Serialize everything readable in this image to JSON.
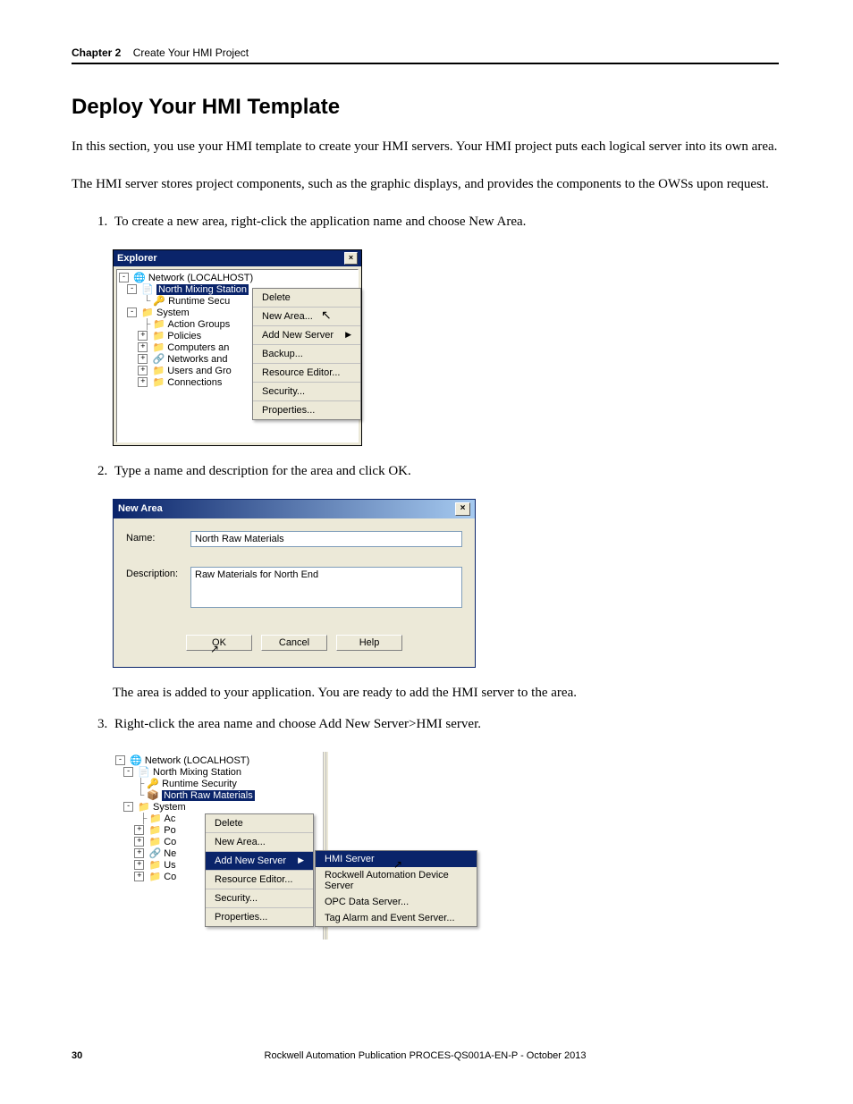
{
  "header": {
    "chapter": "Chapter 2",
    "title": "Create Your HMI Project"
  },
  "heading": "Deploy Your HMI Template",
  "p1": "In this section, you use your HMI template to create your HMI servers. Your HMI project puts each logical server into its own area.",
  "p2": "The HMI server stores project components, such as the graphic displays, and provides the components to the OWSs upon request.",
  "step1": "To create a new area, right-click the application name and choose New Area.",
  "step2": "Type a name and description for the area and click OK.",
  "step2_note": "The area is added to your application. You are ready to add the HMI server to the area.",
  "step3": "Right-click the area name and choose Add New Server>HMI server.",
  "explorer": {
    "title": "Explorer",
    "root": "Network (LOCALHOST)",
    "app": "North Mixing Station",
    "rsec": "Runtime Secu",
    "system": "System",
    "ag": "Action Groups",
    "pol": "Policies",
    "comp": "Computers an",
    "net": "Networks and",
    "usr": "Users and Gro",
    "con": "Connections"
  },
  "ctx": {
    "delete": "Delete",
    "newarea": "New Area...",
    "addserver": "Add New Server",
    "backup": "Backup...",
    "resed": "Resource Editor...",
    "security": "Security...",
    "props": "Properties..."
  },
  "dialog": {
    "title": "New Area",
    "name_label": "Name:",
    "name_val": "North Raw Materials",
    "desc_label": "Description:",
    "desc_val": "Raw Materials for North End",
    "ok": "OK",
    "cancel": "Cancel",
    "help": "Help"
  },
  "fig3": {
    "root": "Network (LOCALHOST)",
    "app": "North Mixing Station",
    "rsec": "Runtime Security",
    "nrm": "North Raw Materials",
    "system": "System",
    "ac": "Ac",
    "po": "Po",
    "co": "Co",
    "ne": "Ne",
    "us": "Us",
    "co2": "Co"
  },
  "submenu": {
    "hmi": "HMI Server",
    "rads": "Rockwell Automation Device Server",
    "opc": "OPC Data Server...",
    "tag": "Tag Alarm and Event Server..."
  },
  "footer": {
    "page": "30",
    "pub": "Rockwell Automation Publication PROCES-QS001A-EN-P - October 2013"
  }
}
